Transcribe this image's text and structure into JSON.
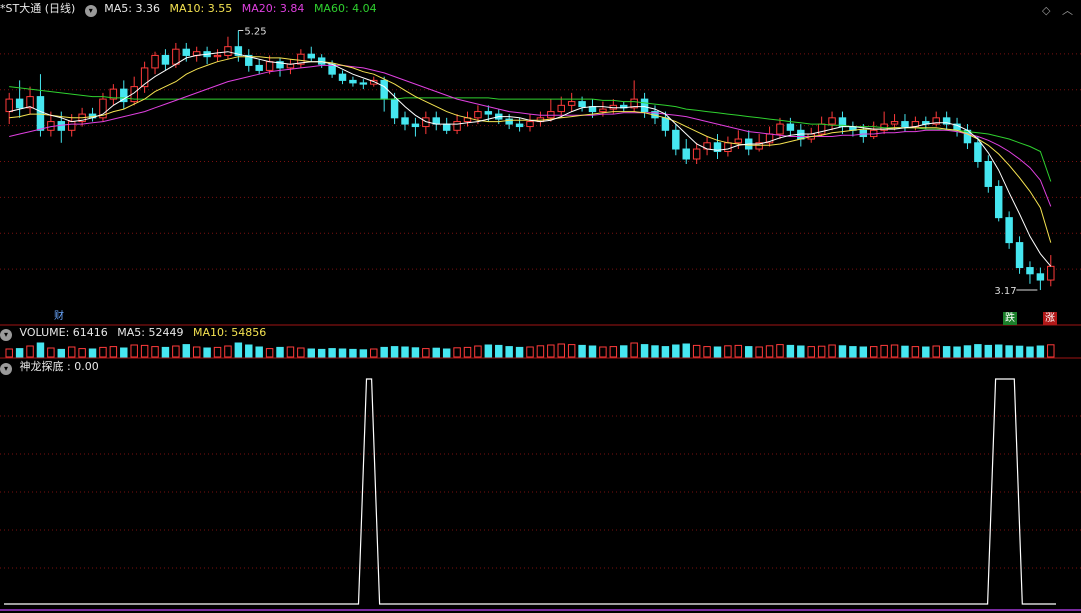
{
  "header": {
    "title": "*ST大通 (日线)",
    "ma5_label": "MA5: 3.36",
    "ma10_label": "MA10: 3.55",
    "ma20_label": "MA20: 3.84",
    "ma60_label": "MA60: 4.04"
  },
  "volume_legend": {
    "title": "VOLUME: 61416",
    "ma5_label": "MA5: 52449",
    "ma10_label": "MA10: 54856"
  },
  "indicator_legend": {
    "title": "神龙探底 : 0.00"
  },
  "badges": {
    "cai": "财",
    "die": "跌",
    "zhang": "涨"
  },
  "colors": {
    "up": "#ff3b3b",
    "down": "#46e6f0",
    "ma5": "#ffffff",
    "ma10": "#f5e351",
    "ma20": "#e040e0",
    "ma60": "#2fd12f",
    "grid": "#7a1010",
    "indicator": "#ffffff"
  },
  "chart_data": {
    "type": "candlestick",
    "price_range": [
      3.05,
      5.35
    ],
    "high_label": "5.25",
    "low_label": "3.17",
    "candles": [
      [
        4.6,
        4.7,
        4.75,
        4.5
      ],
      [
        4.7,
        4.63,
        4.85,
        4.55
      ],
      [
        4.63,
        4.72,
        4.8,
        4.58
      ],
      [
        4.72,
        4.45,
        4.9,
        4.4
      ],
      [
        4.45,
        4.52,
        4.6,
        4.4
      ],
      [
        4.52,
        4.45,
        4.6,
        4.35
      ],
      [
        4.45,
        4.52,
        4.58,
        4.4
      ],
      [
        4.52,
        4.58,
        4.63,
        4.48
      ],
      [
        4.58,
        4.55,
        4.63,
        4.52
      ],
      [
        4.55,
        4.7,
        4.75,
        4.52
      ],
      [
        4.7,
        4.78,
        4.82,
        4.65
      ],
      [
        4.78,
        4.68,
        4.85,
        4.62
      ],
      [
        4.68,
        4.8,
        4.88,
        4.65
      ],
      [
        4.8,
        4.95,
        5.0,
        4.75
      ],
      [
        4.95,
        5.05,
        5.08,
        4.9
      ],
      [
        5.05,
        4.98,
        5.1,
        4.93
      ],
      [
        4.98,
        5.1,
        5.15,
        4.95
      ],
      [
        5.1,
        5.05,
        5.15,
        5.0
      ],
      [
        5.05,
        5.08,
        5.12,
        5.0
      ],
      [
        5.08,
        5.04,
        5.12,
        4.98
      ],
      [
        5.04,
        5.05,
        5.1,
        5.0
      ],
      [
        5.05,
        5.12,
        5.2,
        5.02
      ],
      [
        5.12,
        5.05,
        5.25,
        5.0
      ],
      [
        5.05,
        4.97,
        5.1,
        4.92
      ],
      [
        4.97,
        4.93,
        5.02,
        4.9
      ],
      [
        4.93,
        5.0,
        5.05,
        4.9
      ],
      [
        5.0,
        4.95,
        5.03,
        4.88
      ],
      [
        4.95,
        4.98,
        5.02,
        4.9
      ],
      [
        4.98,
        5.06,
        5.1,
        4.95
      ],
      [
        5.06,
        5.03,
        5.12,
        5.0
      ],
      [
        5.03,
        4.98,
        5.06,
        4.95
      ],
      [
        4.98,
        4.9,
        5.01,
        4.87
      ],
      [
        4.9,
        4.85,
        4.93,
        4.82
      ],
      [
        4.85,
        4.83,
        4.88,
        4.8
      ],
      [
        4.83,
        4.82,
        4.86,
        4.78
      ],
      [
        4.82,
        4.85,
        4.88,
        4.8
      ],
      [
        4.85,
        4.7,
        4.88,
        4.6
      ],
      [
        4.7,
        4.55,
        4.75,
        4.5
      ],
      [
        4.55,
        4.5,
        4.6,
        4.45
      ],
      [
        4.5,
        4.48,
        4.55,
        4.4
      ],
      [
        4.48,
        4.55,
        4.6,
        4.42
      ],
      [
        4.55,
        4.5,
        4.6,
        4.45
      ],
      [
        4.5,
        4.45,
        4.55,
        4.42
      ],
      [
        4.45,
        4.52,
        4.58,
        4.42
      ],
      [
        4.52,
        4.55,
        4.6,
        4.48
      ],
      [
        4.55,
        4.6,
        4.65,
        4.5
      ],
      [
        4.6,
        4.58,
        4.65,
        4.52
      ],
      [
        4.58,
        4.54,
        4.62,
        4.5
      ],
      [
        4.54,
        4.5,
        4.58,
        4.46
      ],
      [
        4.5,
        4.48,
        4.55,
        4.44
      ],
      [
        4.48,
        4.52,
        4.58,
        4.44
      ],
      [
        4.52,
        4.55,
        4.6,
        4.48
      ],
      [
        4.55,
        4.6,
        4.7,
        4.52
      ],
      [
        4.6,
        4.65,
        4.72,
        4.55
      ],
      [
        4.65,
        4.68,
        4.75,
        4.6
      ],
      [
        4.68,
        4.64,
        4.72,
        4.6
      ],
      [
        4.64,
        4.6,
        4.7,
        4.55
      ],
      [
        4.6,
        4.62,
        4.68,
        4.56
      ],
      [
        4.62,
        4.65,
        4.7,
        4.58
      ],
      [
        4.65,
        4.63,
        4.68,
        4.6
      ],
      [
        4.63,
        4.7,
        4.85,
        4.6
      ],
      [
        4.7,
        4.6,
        4.75,
        4.55
      ],
      [
        4.6,
        4.55,
        4.65,
        4.5
      ],
      [
        4.55,
        4.45,
        4.6,
        4.4
      ],
      [
        4.45,
        4.3,
        4.5,
        4.25
      ],
      [
        4.3,
        4.22,
        4.38,
        4.18
      ],
      [
        4.22,
        4.3,
        4.35,
        4.18
      ],
      [
        4.3,
        4.35,
        4.4,
        4.25
      ],
      [
        4.35,
        4.28,
        4.42,
        4.22
      ],
      [
        4.28,
        4.35,
        4.4,
        4.24
      ],
      [
        4.35,
        4.38,
        4.45,
        4.3
      ],
      [
        4.38,
        4.3,
        4.45,
        4.25
      ],
      [
        4.3,
        4.35,
        4.42,
        4.28
      ],
      [
        4.35,
        4.42,
        4.48,
        4.32
      ],
      [
        4.42,
        4.5,
        4.55,
        4.38
      ],
      [
        4.5,
        4.45,
        4.55,
        4.4
      ],
      [
        4.45,
        4.38,
        4.5,
        4.32
      ],
      [
        4.38,
        4.42,
        4.47,
        4.35
      ],
      [
        4.42,
        4.5,
        4.56,
        4.4
      ],
      [
        4.5,
        4.55,
        4.6,
        4.45
      ],
      [
        4.55,
        4.48,
        4.6,
        4.42
      ],
      [
        4.48,
        4.45,
        4.52,
        4.4
      ],
      [
        4.45,
        4.4,
        4.5,
        4.35
      ],
      [
        4.4,
        4.45,
        4.52,
        4.38
      ],
      [
        4.45,
        4.5,
        4.6,
        4.42
      ],
      [
        4.5,
        4.52,
        4.58,
        4.45
      ],
      [
        4.52,
        4.48,
        4.58,
        4.44
      ],
      [
        4.48,
        4.52,
        4.56,
        4.45
      ],
      [
        4.52,
        4.5,
        4.56,
        4.46
      ],
      [
        4.5,
        4.55,
        4.6,
        4.48
      ],
      [
        4.55,
        4.5,
        4.6,
        4.45
      ],
      [
        4.5,
        4.45,
        4.55,
        4.4
      ],
      [
        4.45,
        4.35,
        4.5,
        4.3
      ],
      [
        4.35,
        4.2,
        4.4,
        4.15
      ],
      [
        4.2,
        4.0,
        4.25,
        3.95
      ],
      [
        4.0,
        3.75,
        4.05,
        3.72
      ],
      [
        3.75,
        3.55,
        3.8,
        3.5
      ],
      [
        3.55,
        3.35,
        3.6,
        3.3
      ],
      [
        3.35,
        3.3,
        3.4,
        3.22
      ],
      [
        3.3,
        3.25,
        3.35,
        3.17
      ],
      [
        3.25,
        3.36,
        3.45,
        3.2
      ]
    ],
    "ma5": [
      4.6,
      4.62,
      4.64,
      4.6,
      4.57,
      4.55,
      4.52,
      4.53,
      4.55,
      4.58,
      4.65,
      4.7,
      4.75,
      4.82,
      4.88,
      4.93,
      4.98,
      5.03,
      5.05,
      5.06,
      5.07,
      5.08,
      5.06,
      5.04,
      5.02,
      5.0,
      4.99,
      4.98,
      4.99,
      5.0,
      5.0,
      4.98,
      4.94,
      4.9,
      4.87,
      4.84,
      4.8,
      4.72,
      4.64,
      4.57,
      4.52,
      4.5,
      4.5,
      4.5,
      4.51,
      4.52,
      4.54,
      4.56,
      4.56,
      4.55,
      4.53,
      4.52,
      4.53,
      4.56,
      4.6,
      4.63,
      4.64,
      4.64,
      4.63,
      4.63,
      4.64,
      4.64,
      4.62,
      4.58,
      4.5,
      4.42,
      4.34,
      4.3,
      4.29,
      4.3,
      4.33,
      4.34,
      4.34,
      4.36,
      4.39,
      4.41,
      4.42,
      4.42,
      4.44,
      4.46,
      4.48,
      4.48,
      4.47,
      4.46,
      4.46,
      4.46,
      4.47,
      4.48,
      4.5,
      4.51,
      4.51,
      4.49,
      4.45,
      4.38,
      4.27,
      4.13,
      3.95,
      3.78,
      3.6,
      3.46,
      3.36
    ],
    "ma10": [
      4.55,
      4.56,
      4.58,
      4.58,
      4.57,
      4.56,
      4.55,
      4.55,
      4.56,
      4.57,
      4.6,
      4.62,
      4.66,
      4.7,
      4.76,
      4.8,
      4.84,
      4.9,
      4.94,
      4.97,
      5.0,
      5.02,
      5.04,
      5.04,
      5.04,
      5.03,
      5.03,
      5.02,
      5.01,
      5.0,
      5.0,
      4.99,
      4.97,
      4.95,
      4.92,
      4.9,
      4.86,
      4.82,
      4.77,
      4.72,
      4.68,
      4.64,
      4.6,
      4.57,
      4.55,
      4.53,
      4.52,
      4.52,
      4.53,
      4.53,
      4.53,
      4.53,
      4.54,
      4.55,
      4.56,
      4.57,
      4.58,
      4.59,
      4.6,
      4.6,
      4.6,
      4.59,
      4.57,
      4.55,
      4.52,
      4.48,
      4.44,
      4.4,
      4.37,
      4.35,
      4.34,
      4.33,
      4.33,
      4.33,
      4.34,
      4.36,
      4.38,
      4.4,
      4.41,
      4.43,
      4.44,
      4.45,
      4.46,
      4.46,
      4.46,
      4.47,
      4.47,
      4.47,
      4.47,
      4.47,
      4.46,
      4.45,
      4.42,
      4.38,
      4.33,
      4.26,
      4.17,
      4.07,
      3.96,
      3.83,
      3.55
    ],
    "ma20": [
      4.4,
      4.42,
      4.44,
      4.46,
      4.48,
      4.49,
      4.5,
      4.5,
      4.51,
      4.52,
      4.54,
      4.56,
      4.58,
      4.6,
      4.63,
      4.66,
      4.69,
      4.72,
      4.75,
      4.78,
      4.81,
      4.84,
      4.86,
      4.88,
      4.9,
      4.92,
      4.93,
      4.94,
      4.95,
      4.96,
      4.97,
      4.97,
      4.97,
      4.96,
      4.95,
      4.93,
      4.91,
      4.88,
      4.85,
      4.82,
      4.79,
      4.76,
      4.73,
      4.7,
      4.68,
      4.66,
      4.64,
      4.62,
      4.6,
      4.59,
      4.58,
      4.57,
      4.57,
      4.57,
      4.57,
      4.57,
      4.57,
      4.58,
      4.58,
      4.59,
      4.59,
      4.59,
      4.59,
      4.58,
      4.57,
      4.56,
      4.54,
      4.52,
      4.5,
      4.48,
      4.46,
      4.44,
      4.43,
      4.42,
      4.41,
      4.4,
      4.4,
      4.4,
      4.4,
      4.4,
      4.41,
      4.41,
      4.42,
      4.42,
      4.43,
      4.43,
      4.44,
      4.44,
      4.45,
      4.45,
      4.45,
      4.44,
      4.42,
      4.4,
      4.37,
      4.33,
      4.28,
      4.22,
      4.15,
      4.05,
      3.84
    ],
    "ma60": [
      4.8,
      4.79,
      4.78,
      4.77,
      4.76,
      4.75,
      4.74,
      4.73,
      4.72,
      4.72,
      4.71,
      4.71,
      4.7,
      4.7,
      4.7,
      4.7,
      4.7,
      4.7,
      4.7,
      4.7,
      4.7,
      4.7,
      4.7,
      4.7,
      4.7,
      4.7,
      4.7,
      4.7,
      4.7,
      4.7,
      4.7,
      4.7,
      4.7,
      4.7,
      4.7,
      4.7,
      4.7,
      4.7,
      4.71,
      4.71,
      4.71,
      4.71,
      4.71,
      4.71,
      4.71,
      4.71,
      4.71,
      4.7,
      4.7,
      4.7,
      4.7,
      4.7,
      4.7,
      4.7,
      4.7,
      4.7,
      4.7,
      4.69,
      4.69,
      4.68,
      4.68,
      4.67,
      4.66,
      4.65,
      4.64,
      4.62,
      4.61,
      4.6,
      4.59,
      4.58,
      4.57,
      4.56,
      4.55,
      4.54,
      4.53,
      4.52,
      4.51,
      4.5,
      4.5,
      4.49,
      4.49,
      4.48,
      4.48,
      4.48,
      4.47,
      4.47,
      4.47,
      4.47,
      4.46,
      4.46,
      4.45,
      4.45,
      4.44,
      4.43,
      4.42,
      4.4,
      4.38,
      4.35,
      4.32,
      4.28,
      4.04
    ],
    "volume": [
      40,
      42,
      55,
      70,
      45,
      38,
      50,
      42,
      40,
      48,
      52,
      45,
      60,
      58,
      52,
      48,
      55,
      62,
      50,
      45,
      48,
      55,
      70,
      60,
      50,
      42,
      48,
      50,
      45,
      40,
      38,
      42,
      40,
      38,
      36,
      40,
      48,
      52,
      50,
      46,
      42,
      44,
      40,
      46,
      48,
      55,
      60,
      58,
      52,
      48,
      50,
      56,
      60,
      65,
      62,
      58,
      55,
      50,
      52,
      56,
      70,
      62,
      56,
      52,
      60,
      65,
      58,
      52,
      50,
      56,
      58,
      52,
      50,
      56,
      62,
      58,
      55,
      52,
      54,
      60,
      56,
      52,
      50,
      52,
      58,
      60,
      54,
      52,
      50,
      55,
      52,
      50,
      56,
      62,
      58,
      60,
      56,
      54,
      50,
      55,
      61
    ],
    "indicator_name": "神龙探底",
    "indicator_value": "0.00",
    "indicator_signals": [
      {
        "from": 0.337,
        "to": 0.357
      },
      {
        "from": 0.935,
        "to": 0.968
      }
    ]
  }
}
